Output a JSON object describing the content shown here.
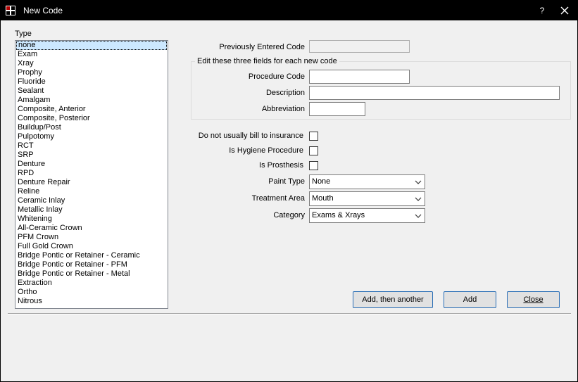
{
  "window": {
    "title": "New Code",
    "help": "?"
  },
  "type_list": {
    "label": "Type",
    "items": [
      "none",
      "Exam",
      "Xray",
      "Prophy",
      "Fluoride",
      "Sealant",
      "Amalgam",
      "Composite, Anterior",
      "Composite, Posterior",
      "Buildup/Post",
      "Pulpotomy",
      "RCT",
      "SRP",
      "Denture",
      "RPD",
      "Denture Repair",
      "Reline",
      "Ceramic Inlay",
      "Metallic Inlay",
      "Whitening",
      "All-Ceramic Crown",
      "PFM Crown",
      "Full Gold Crown",
      "Bridge Pontic or Retainer - Ceramic",
      "Bridge Pontic or Retainer - PFM",
      "Bridge Pontic or Retainer - Metal",
      "Extraction",
      "Ortho",
      "Nitrous"
    ],
    "selected_index": 0
  },
  "form": {
    "previously_entered_label": "Previously Entered Code",
    "previously_entered_value": "",
    "group_title": "Edit these three fields for each new code",
    "procedure_code_label": "Procedure Code",
    "procedure_code_value": "",
    "description_label": "Description",
    "description_value": "",
    "abbreviation_label": "Abbreviation",
    "abbreviation_value": "",
    "no_bill_label": "Do not usually bill to insurance",
    "hygiene_label": "Is Hygiene Procedure",
    "prosthesis_label": "Is Prosthesis",
    "paint_type_label": "Paint Type",
    "paint_type_value": "None",
    "treatment_area_label": "Treatment Area",
    "treatment_area_value": "Mouth",
    "category_label": "Category",
    "category_value": "Exams & Xrays"
  },
  "buttons": {
    "add_another": "Add, then another",
    "add": "Add",
    "close": "Close"
  }
}
